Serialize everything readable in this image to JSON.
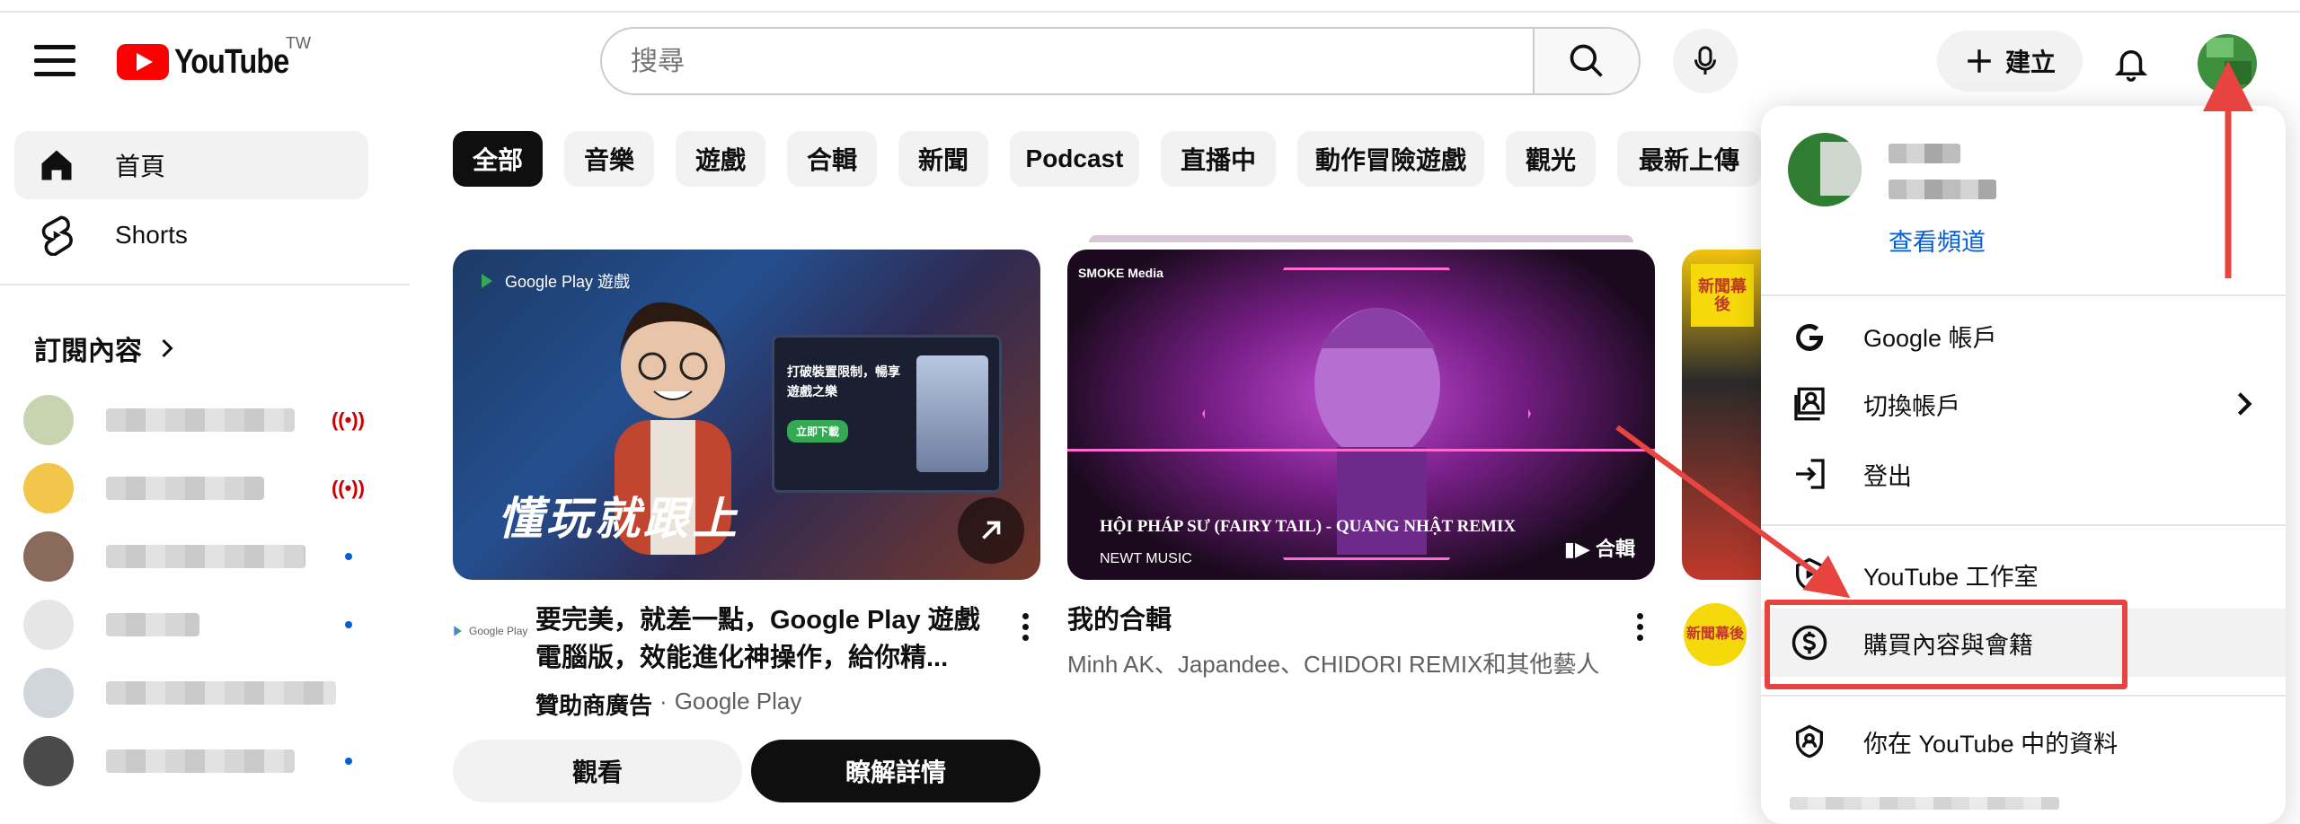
{
  "header": {
    "logo_text": "YouTube",
    "country_code": "TW",
    "search_placeholder": "搜尋",
    "create_label": "建立"
  },
  "sidebar": {
    "items": [
      {
        "label": "首頁",
        "icon": "home-icon",
        "active": true
      },
      {
        "label": "Shorts",
        "icon": "shorts-icon",
        "active": false
      }
    ],
    "subscriptions_title": "訂閱內容",
    "subscriptions": [
      {
        "status": "live",
        "avatar_color": "#c8d4b0"
      },
      {
        "status": "live",
        "avatar_color": "#f2c64a"
      },
      {
        "status": "new",
        "avatar_color": "#8a6a5a"
      },
      {
        "status": "new",
        "avatar_color": "#e6e6e6"
      },
      {
        "status": "none",
        "avatar_color": "#d0d6dc"
      },
      {
        "status": "new",
        "avatar_color": "#4a4a4a"
      }
    ],
    "live_indicator": "((•))"
  },
  "chips": [
    "全部",
    "音樂",
    "遊戲",
    "合輯",
    "新聞",
    "Podcast",
    "直播中",
    "動作冒險遊戲",
    "觀光",
    "最新上傳"
  ],
  "videos": [
    {
      "thumb_badge": "Google Play 遊戲",
      "thumb_promo_line1": "打破裝置限制，暢享",
      "thumb_promo_line2": "遊戲之樂",
      "thumb_promo_button": "立即下載",
      "thumb_title": "懂玩就跟上",
      "channel_logo": "Google Play",
      "title_line1": "要完美，就差一點，Google Play 遊戲",
      "title_line2": "電腦版，效能進化神操作，給你精...",
      "sponsor_label": "贊助商廣告",
      "separator": "·",
      "advertiser": "Google Play",
      "watch_label": "觀看",
      "learn_more_label": "瞭解詳情"
    },
    {
      "thumb_brand": "SMOKE Media",
      "thumb_title": "HỘI PHÁP SƯ (FAIRY TAIL) - QUANG NHẬT REMIX",
      "thumb_label": "NEWT MUSIC",
      "thumb_tag": "合輯",
      "title": "我的合輯",
      "meta": "Minh AK、Japandee、CHIDORI REMIX和其他藝人"
    },
    {
      "channel_badge": "新聞幕後"
    }
  ],
  "account_menu": {
    "view_channel": "查看頻道",
    "items": [
      {
        "label": "Google 帳戶",
        "icon": "google-icon"
      },
      {
        "label": "切換帳戶",
        "icon": "switch-account-icon",
        "has_submenu": true
      },
      {
        "label": "登出",
        "icon": "sign-out-icon"
      },
      {
        "label": "YouTube 工作室",
        "icon": "studio-icon"
      },
      {
        "label": "購買內容與會籍",
        "icon": "purchases-icon",
        "highlighted": true
      },
      {
        "label": "你在 YouTube 中的資料",
        "icon": "your-data-icon"
      }
    ]
  },
  "annotation_colors": {
    "arrow": "#e8443f"
  }
}
